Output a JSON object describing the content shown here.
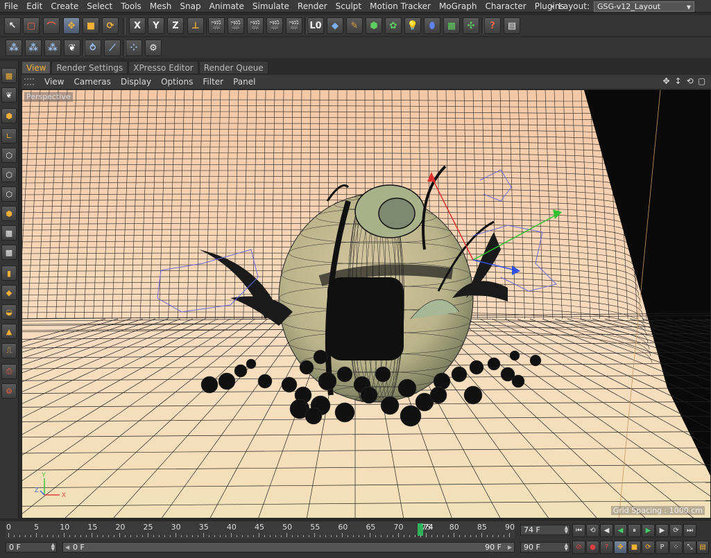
{
  "menu": [
    "File",
    "Edit",
    "Create",
    "Select",
    "Tools",
    "Mesh",
    "Snap",
    "Animate",
    "Simulate",
    "Render",
    "Sculpt",
    "Motion Tracker",
    "MoGraph",
    "Character",
    "Plugins"
  ],
  "layout": {
    "label": "Layout:",
    "value": "GSG-v12_Layout"
  },
  "toolbar1": {
    "axis_x": "X",
    "axis_y": "Y",
    "axis_z": "Z"
  },
  "tabs": [
    "View",
    "Render Settings",
    "XPresso Editor",
    "Render Queue"
  ],
  "viewport_menu": [
    "View",
    "Cameras",
    "Display",
    "Options",
    "Filter",
    "Panel"
  ],
  "viewport": {
    "label": "Perspective",
    "grid_spacing": "Grid Spacing : 1000 cm",
    "axis_x": "X",
    "axis_y": "Y",
    "axis_z": "Z"
  },
  "timeline": {
    "ticks": [
      "0",
      "5",
      "10",
      "15",
      "20",
      "25",
      "30",
      "35",
      "40",
      "45",
      "50",
      "55",
      "60",
      "65",
      "70",
      "75",
      "80",
      "85",
      "90"
    ],
    "playhead_label": "74",
    "current_frame": "74 F",
    "start_frame": "0 F",
    "range_start": "0 F",
    "range_end": "90 F",
    "end_frame": "90 F"
  },
  "colors": {
    "accent": "#f2b134",
    "playhead": "#2fb35a",
    "viewport_bg": "#f0c9a8",
    "wire": "#1a1a1a"
  }
}
